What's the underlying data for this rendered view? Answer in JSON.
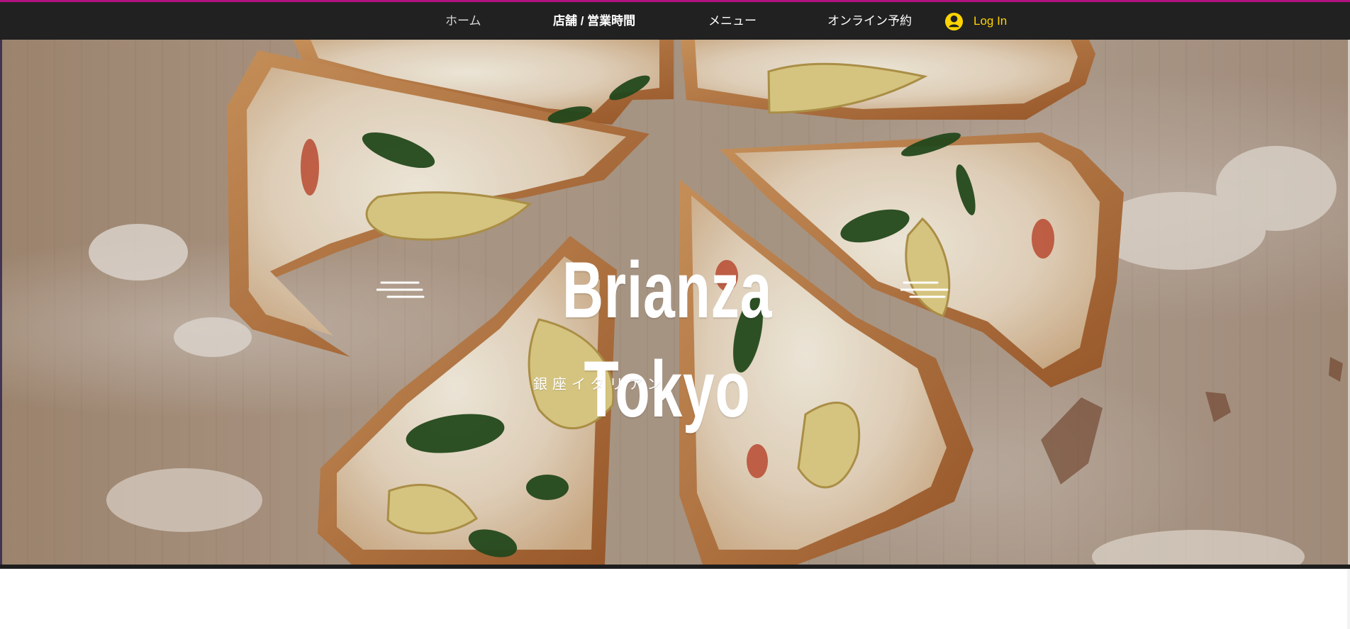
{
  "nav": {
    "items": [
      {
        "label": "ホーム",
        "active": true
      },
      {
        "label": "店舗 / 営業時間",
        "active": false
      },
      {
        "label": "メニュー",
        "active": false
      },
      {
        "label": "オンライン予約",
        "active": false
      }
    ],
    "login_label": "Log In",
    "login_icon": "user-avatar-icon",
    "colors": {
      "nav_bg": "#212121",
      "accent_top": "#b0127f",
      "login": "#ffd400"
    }
  },
  "hero": {
    "title": "Brianza Tokyo",
    "subtitle": "銀座イタリアン",
    "decorative_icon": "speed-lines-icon",
    "background_image": "sliced pizza on floured wooden board"
  }
}
